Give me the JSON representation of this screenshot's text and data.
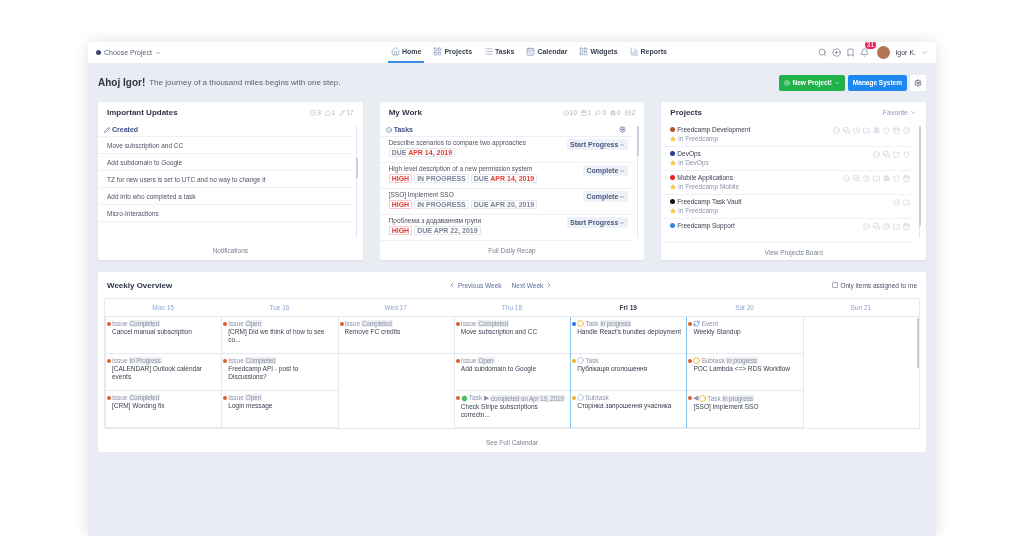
{
  "nav": {
    "project_selector": "Choose Project",
    "tabs": [
      {
        "label": "Home",
        "selected": true
      },
      {
        "label": "Projects",
        "selected": false
      },
      {
        "label": "Tasks",
        "selected": false
      },
      {
        "label": "Calendar",
        "selected": false
      },
      {
        "label": "Widgets",
        "selected": false
      },
      {
        "label": "Reports",
        "selected": false
      }
    ],
    "notification_count": "31",
    "user": "Igor K."
  },
  "greeting": {
    "title": "Ahoj Igor!",
    "text": "The journey of a thousand miles begins with one step.",
    "buttons": [
      {
        "label": "New Project!",
        "kind": "success"
      },
      {
        "label": "Manage System",
        "kind": "primary"
      }
    ]
  },
  "updates": {
    "title": "Important Updates",
    "counters": [
      "3",
      "1",
      "17"
    ],
    "section": "Created",
    "items": [
      "Move subscription and CC",
      "Add subdomain to Google",
      "TZ for new users is set to UTC and no way to change it",
      "Add info who completed a task",
      "Micro-Interactions"
    ],
    "footer": "Notifications"
  },
  "my_work": {
    "title": "My Work",
    "counters": [
      "10",
      "1",
      "0",
      "0",
      "2"
    ],
    "section": "Tasks",
    "tasks": [
      {
        "title": "Describe scenarios to compare two approaches",
        "action": "Start Progress",
        "tags": [
          {
            "kind": "due",
            "prefix": "DUE",
            "text": "APR 14, 2019",
            "overdue": true
          }
        ]
      },
      {
        "title": "High level description of a new permission system",
        "action": "Complete",
        "tags": [
          {
            "kind": "priority",
            "text": "HIGH"
          },
          {
            "kind": "status",
            "text": "IN PROGRESS"
          },
          {
            "kind": "due",
            "prefix": "DUE",
            "text": "APR 14, 2019",
            "overdue": true
          }
        ]
      },
      {
        "title": "[SSO] Implement SSO",
        "action": "Complete",
        "tags": [
          {
            "kind": "priority",
            "text": "HIGH"
          },
          {
            "kind": "status",
            "text": "IN PROGRESS"
          },
          {
            "kind": "due",
            "prefix": "DUE",
            "text": "APR 20, 2019",
            "overdue": false
          }
        ]
      },
      {
        "title": "Проблема з додаванням групи",
        "action": "Start Progress",
        "tags": [
          {
            "kind": "priority",
            "text": "HIGH"
          },
          {
            "kind": "due",
            "prefix": "DUE",
            "text": "APR 22, 2019",
            "overdue": false
          }
        ]
      }
    ],
    "footer": "Full Daily Recap"
  },
  "projects": {
    "title": "Projects",
    "filter": "Favorite",
    "items": [
      {
        "name": "Freedcamp Development",
        "color": "#b5532a",
        "group": "in Freedcamp"
      },
      {
        "name": "DevOps",
        "color": "#2b3a9e",
        "group": "in DevOps"
      },
      {
        "name": "Mobile Applications",
        "color": "#e8201e",
        "group": "in Freedcamp Mobile"
      },
      {
        "name": "Freedcamp Task Vault",
        "color": "#111111",
        "group": "in Freedcamp"
      },
      {
        "name": "Freedcamp Support",
        "color": "#3f7fe0"
      }
    ],
    "footer": "View Projects Board"
  },
  "weekly": {
    "title": "Weekly Overview",
    "previous": "Previous Week",
    "next": "Next Week",
    "filter": {
      "label": "Only items assigned to me",
      "checked": false
    },
    "footer": "See Full Calendar",
    "days": [
      {
        "label": "Mon 15",
        "today": false,
        "highlighted": false,
        "events": [
          {
            "kind": "plain",
            "type": "Issue",
            "status": "Completed",
            "title": "Cancel manual subscription",
            "color": "#d9602c"
          },
          {
            "kind": "plain",
            "type": "Issue",
            "status": "In Progress",
            "title": "[CALENDAR] Outlook calendar events",
            "color": "#d9602c"
          },
          {
            "kind": "plain",
            "type": "Issue",
            "status": "Completed",
            "title": "[CRM] Wording fix",
            "color": "#d9602c"
          }
        ]
      },
      {
        "label": "Tue 16",
        "today": false,
        "highlighted": false,
        "events": [
          {
            "kind": "plain",
            "type": "Issue",
            "status": "Open",
            "title": "[CRM] Did we think of how to see co...",
            "color": "#d9602c"
          },
          {
            "kind": "plain",
            "type": "Issue",
            "status": "Completed",
            "title": "Freedcamp API - post to Discussions?",
            "color": "#d9602c"
          },
          {
            "kind": "plain",
            "type": "Issue",
            "status": "Open",
            "title": "Login message",
            "color": "#d9602c"
          }
        ]
      },
      {
        "label": "Wed 17",
        "today": false,
        "highlighted": false,
        "events": [
          {
            "kind": "plain",
            "type": "Issue",
            "status": "Completed",
            "title": "Remove FC credits",
            "color": "#d9602c"
          }
        ]
      },
      {
        "label": "Thu 18",
        "today": false,
        "highlighted": false,
        "events": [
          {
            "kind": "plain",
            "type": "Issue",
            "status": "Completed",
            "title": "Move subscription and CC",
            "color": "#d9602c"
          },
          {
            "kind": "plain",
            "type": "Issue",
            "status": "Open",
            "title": "Add subdomain to Google",
            "color": "#d9602c"
          },
          {
            "kind": "done",
            "type": "Task ▶",
            "status": "completed on Apr 19, 2019",
            "title": "Check Stripe subscriptions correctn...",
            "color": "#d9602c"
          }
        ]
      },
      {
        "label": "Fri 19",
        "today": true,
        "highlighted": true,
        "events": [
          {
            "kind": "progress",
            "type": "Task",
            "status": "in progress",
            "title": "Handle React's bundles deployment",
            "color": "#2a6ee0"
          },
          {
            "kind": "open",
            "type": "Task",
            "title": "Публікація оголошення",
            "color": "#f2b21b"
          },
          {
            "kind": "open",
            "type": "Subtask",
            "title": "Сторінка запрошення учасника",
            "color": "#f2b21b"
          }
        ]
      },
      {
        "label": "Sat 20",
        "today": false,
        "highlighted": true,
        "events": [
          {
            "kind": "recurring",
            "type": "Event",
            "title": "Weekly Standup",
            "color": "#d9602c"
          },
          {
            "kind": "progress",
            "type": "Subtask",
            "status": "in progress",
            "title": "POC Lambda <=> RDS Workflow",
            "color": "#d9602c"
          },
          {
            "kind": "progress",
            "prefix": "◀",
            "type": "Task",
            "status": "in progress",
            "title": "[SSO] Implement SSO",
            "color": "#d9602c"
          }
        ]
      },
      {
        "label": "Sun 21",
        "today": false,
        "highlighted": false
      }
    ]
  }
}
